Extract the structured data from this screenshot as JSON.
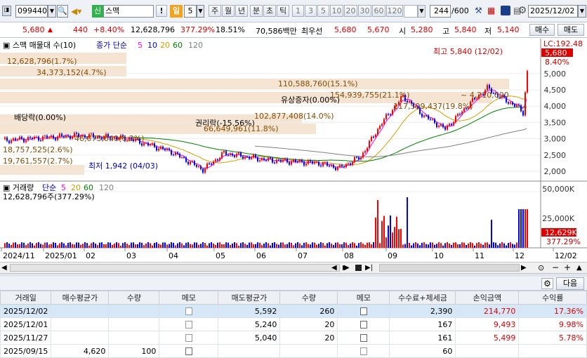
{
  "toolbar": {
    "code": "099440",
    "market_badge": "신",
    "name": "스맥",
    "excl": "!",
    "il": "일",
    "il_num": "5",
    "periods": [
      "주",
      "월",
      "년",
      "분",
      "초",
      "틱"
    ],
    "nums": [
      "1",
      "3",
      "5",
      "10",
      "20",
      "30",
      "60",
      "120"
    ],
    "count": "244",
    "total": "/600",
    "date": "2025/12/02"
  },
  "quote": {
    "price": "5,680",
    "tri": "▲",
    "change": "440",
    "pct": "+8.40%",
    "volume": "12,628,796",
    "vol_pct": "377.29%",
    "turnover": "18.51%",
    "amount": "70,586백만",
    "priority": "최우선",
    "bid1": "5,680",
    "bid2": "5,670",
    "open_l": "시",
    "open": "5,280",
    "high_l": "고",
    "high": "5,840",
    "low_l": "저",
    "low": "5,140",
    "buy": "매수",
    "sell": "매도"
  },
  "chart": {
    "legend": {
      "name": "스맥 매물대 수(10)",
      "ma_title": "종가 단순",
      "ma": [
        "5",
        "10",
        "20",
        "60",
        "120"
      ],
      "ma_colors": [
        "#ff00ff",
        "#0000ff",
        "#d4a000",
        "#008000",
        "#808080"
      ]
    },
    "y_ticks": [
      "5,000",
      "4,500",
      "4,000",
      "3,500",
      "3,000",
      "2,500",
      "2,000"
    ],
    "y_right": {
      "lc": "LC:192.48",
      "price": "5,680",
      "pct": "8.40%"
    },
    "annotations": {
      "vp1": "12,628,796(1.7%)",
      "vp2": "34,373,152(4.7%)",
      "vp3": "110,588,760(15.1%)",
      "vp4": "154,939,755(21.1%)",
      "vp5": "102,877,408(14.0%)",
      "vp6": "66,649,961(11.8%)",
      "vp7": "46,073,640(6.3%)",
      "vp8": "18,757,525(2.6%)",
      "vp9": "19,761,557(2.7%)",
      "vp10": "117,599,437(19.8%)",
      "range": "4,210,000",
      "dividend": "배당락(0.00%)",
      "rights": "권리락(-15.56%)",
      "capital": "유상증자(0.00%)",
      "low": "최저 1,942 (04/03)",
      "high": "최고 5,840 (12/02)"
    },
    "volume_legend": {
      "title": "거래량",
      "ma_title": "단순",
      "ma": [
        "5",
        "20",
        "60",
        "120"
      ],
      "ma_colors": [
        "#ff00ff",
        "#d4a000",
        "#008000",
        "#808080"
      ],
      "value": "12,628,796주(377.29%)"
    },
    "vol_ticks": [
      "50,000K",
      "25,000K"
    ],
    "vol_right": {
      "value": "12,629K",
      "pct": "377.29%"
    },
    "x_labels": [
      "2024/11",
      "2025/01",
      "02",
      "03",
      "04",
      "05",
      "06",
      "07",
      "08",
      "09",
      "10",
      "11",
      "12",
      "12/02"
    ],
    "colors": {
      "up": "#ff0000",
      "down": "#0000ff",
      "band": "#f5e4d2",
      "bg": "#ffffff"
    }
  },
  "panel": {
    "next": "다음"
  },
  "trades": {
    "headers": [
      "거래일",
      "매수평균가",
      "수량",
      "메모",
      "매도평균가",
      "수량",
      "메모",
      "수수료+제세금",
      "손익금액",
      "수익률"
    ],
    "rows": [
      {
        "date": "2025/12/02",
        "buy_avg": "",
        "buy_qty": "",
        "sell_avg": "5,592",
        "sell_qty": "260",
        "fee": "2,390",
        "pnl": "214,770",
        "rate": "17.36%"
      },
      {
        "date": "2025/12/01",
        "buy_avg": "",
        "buy_qty": "",
        "sell_avg": "5,240",
        "sell_qty": "20",
        "fee": "167",
        "pnl": "9,493",
        "rate": "9.98%"
      },
      {
        "date": "2025/11/27",
        "buy_avg": "",
        "buy_qty": "",
        "sell_avg": "5,040",
        "sell_qty": "20",
        "fee": "161",
        "pnl": "5,499",
        "rate": "5.78%"
      },
      {
        "date": "2025/09/15",
        "buy_avg": "4,620",
        "buy_qty": "100",
        "sell_avg": "",
        "sell_qty": "",
        "fee": "60",
        "pnl": "",
        "rate": ""
      }
    ]
  }
}
